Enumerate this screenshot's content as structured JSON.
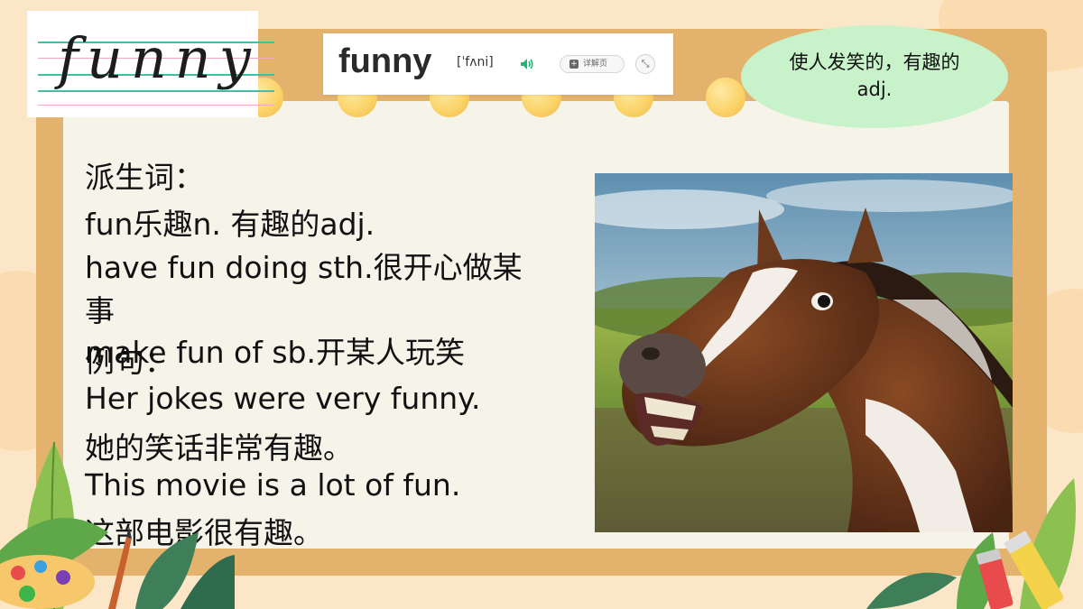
{
  "word_card": {
    "handwritten_word": "funny"
  },
  "dictionary": {
    "word": "funny",
    "phonetic": "[ˈfʌni]",
    "detail_label": "详解页",
    "speaker_icon": "speaker-icon",
    "expand_icon": "expand-icon"
  },
  "meaning": {
    "line1": "使人发笑的，有趣的",
    "line2": "adj."
  },
  "content": {
    "derivatives_heading": "派生词：",
    "line1": "fun乐趣n.   有趣的adj.",
    "line2": "have fun doing sth.很开心做某",
    "line3": "事",
    "line4": "make fun of sb.开某人玩笑",
    "examples_heading": "例句：",
    "ex1_en": "Her jokes were very funny.",
    "ex1_zh": "她的笑话非常有趣。",
    "ex2_en": "This movie is a lot of fun.",
    "ex2_zh": "这部电影很有趣。"
  },
  "colors": {
    "background": "#fbe7c8",
    "frame": "#e3b36e",
    "paper": "#f6f3e9",
    "meaning_bubble": "#c8f2c9",
    "ring": "#fbd46a"
  }
}
